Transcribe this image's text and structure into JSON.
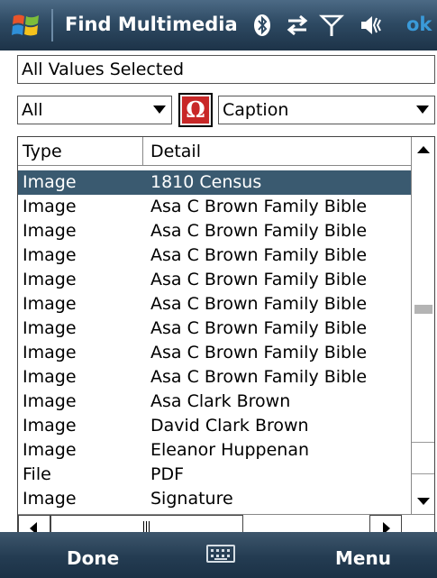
{
  "window": {
    "title": "Find Multimedia",
    "ok_label": "ok"
  },
  "status_icons": [
    "bluetooth-icon",
    "connectivity-icon",
    "signal-icon",
    "volume-icon"
  ],
  "filter": {
    "value": "All Values Selected"
  },
  "type_select": {
    "selected": "All"
  },
  "special_char_button": {
    "glyph": "Ω",
    "color": "#c82828"
  },
  "field_select": {
    "selected": "Caption"
  },
  "list": {
    "columns": [
      "Type",
      "Detail"
    ],
    "selected_index": 0,
    "selection_color": "#3a5a70",
    "rows": [
      {
        "type": "Image",
        "detail": "1810 Census"
      },
      {
        "type": "Image",
        "detail": "Asa C Brown Family Bible"
      },
      {
        "type": "Image",
        "detail": "Asa C Brown Family Bible"
      },
      {
        "type": "Image",
        "detail": "Asa C Brown Family Bible"
      },
      {
        "type": "Image",
        "detail": "Asa C Brown Family Bible"
      },
      {
        "type": "Image",
        "detail": "Asa C Brown Family Bible"
      },
      {
        "type": "Image",
        "detail": "Asa C Brown Family Bible"
      },
      {
        "type": "Image",
        "detail": "Asa C Brown Family Bible"
      },
      {
        "type": "Image",
        "detail": "Asa C Brown Family Bible"
      },
      {
        "type": "Image",
        "detail": "Asa Clark Brown"
      },
      {
        "type": "Image",
        "detail": "David Clark Brown"
      },
      {
        "type": "Image",
        "detail": "Eleanor Huppenan"
      },
      {
        "type": "File",
        "detail": "PDF"
      },
      {
        "type": "Image",
        "detail": "Signature"
      }
    ]
  },
  "softkeys": {
    "left": "Done",
    "right": "Menu",
    "center_icon": "keyboard-icon"
  },
  "colors": {
    "titlebar": "#2e4a63",
    "ok": "#3a9ad9"
  }
}
